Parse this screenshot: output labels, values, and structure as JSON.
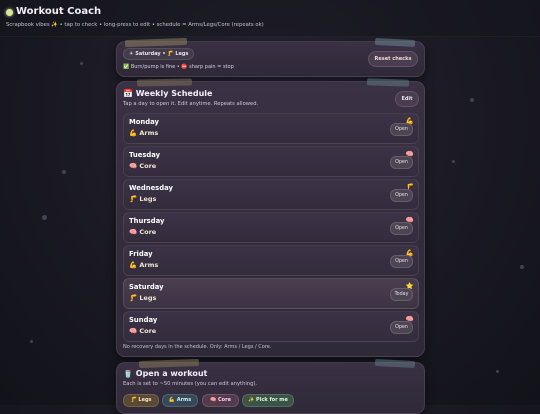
{
  "header": {
    "title": "Workout Coach",
    "subtitle": "Scrapbook vibes ✨ • tap to check • long-press to edit • schedule = Arms/Legs/Core (repeats ok)"
  },
  "today_card": {
    "today_pill": "☀ Saturday • 🦵 Legs",
    "rule_text": "✅ Burn/pump is fine • ⛔ sharp pain = stop",
    "reset_label": "Reset checks"
  },
  "schedule": {
    "icon": "📅",
    "title": "Weekly Schedule",
    "subtitle": "Tap a day to open it. Edit anytime. Repeats allowed.",
    "edit_label": "Edit",
    "days": [
      {
        "name": "Monday",
        "focus": "💪 Arms",
        "button": "Open",
        "emoji": "💪"
      },
      {
        "name": "Tuesday",
        "focus": "🧠 Core",
        "button": "Open",
        "emoji": "🧠"
      },
      {
        "name": "Wednesday",
        "focus": "🦵 Legs",
        "button": "Open",
        "emoji": "🦵"
      },
      {
        "name": "Thursday",
        "focus": "🧠 Core",
        "button": "Open",
        "emoji": "🧠"
      },
      {
        "name": "Friday",
        "focus": "💪 Arms",
        "button": "Open",
        "emoji": "💪"
      },
      {
        "name": "Saturday",
        "focus": "🦵 Legs",
        "button": "Today",
        "emoji": "⭐"
      },
      {
        "name": "Sunday",
        "focus": "🧠 Core",
        "button": "Open",
        "emoji": "🧠"
      }
    ],
    "footnote": "No recovery days in the schedule. Only: Arms / Legs / Core."
  },
  "workout": {
    "icon": "🥤",
    "title": "Open a workout",
    "subtitle": "Each is set to ~50 minutes (you can edit anything).",
    "buttons": [
      {
        "label": "🦵 Legs"
      },
      {
        "label": "💪 Arms"
      },
      {
        "label": "🧠 Core"
      },
      {
        "label": "✨ Pick for me"
      }
    ]
  },
  "colors": {
    "accent": "#f1d6da",
    "card": "#342d3e",
    "background": "#1c1b26"
  }
}
